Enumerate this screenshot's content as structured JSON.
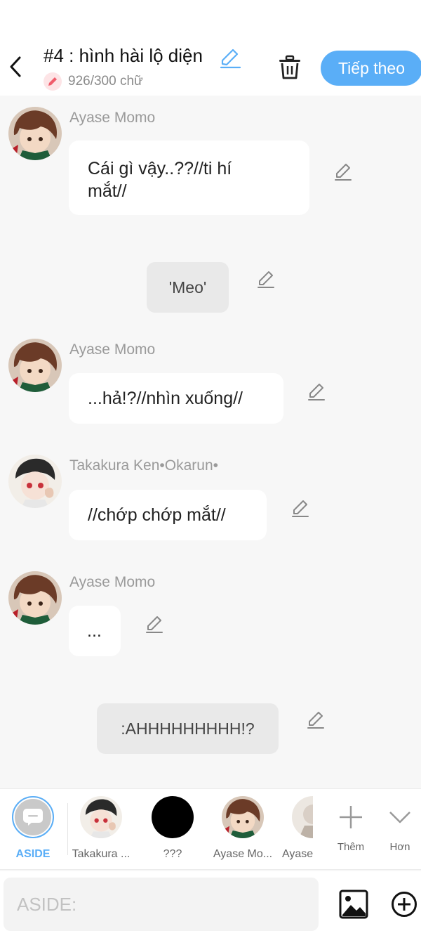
{
  "header": {
    "title": "#4 : hình hài lộ diện",
    "char_count": "926/300 chữ",
    "next_label": "Tiếp theo"
  },
  "messages": [
    {
      "speaker": "Ayase Momo",
      "text_line1": "Cái gì vậy..??//ti hí",
      "text_line2": "mắt//"
    },
    {
      "aside": "'Meo'"
    },
    {
      "speaker": "Ayase Momo",
      "text": "...hả!?//nhìn xuống//"
    },
    {
      "speaker": "Takakura Ken•Okarun•",
      "text": "//chớp chớp mắt//"
    },
    {
      "speaker": "Ayase Momo",
      "text": "..."
    },
    {
      "aside": ":AHHHHHHHHH!?"
    }
  ],
  "picker": {
    "items": [
      {
        "label": "ASIDE"
      },
      {
        "label": "Takakura ..."
      },
      {
        "label": "???"
      },
      {
        "label": "Ayase Mo..."
      },
      {
        "label": "Ayase"
      },
      {
        "label": "Thêm"
      },
      {
        "label": "Hơn"
      }
    ]
  },
  "input": {
    "placeholder": "ASIDE:"
  },
  "colors": {
    "accent": "#5aaef7",
    "bubble": "#ffffff",
    "aside_bubble": "#e9e9e9",
    "background": "#f7f7f7"
  },
  "icons": [
    "back-icon",
    "edit-pencil-icon",
    "trash-icon",
    "image-icon",
    "add-circle-icon",
    "plus-icon",
    "chevron-down-icon",
    "chat-icon"
  ]
}
